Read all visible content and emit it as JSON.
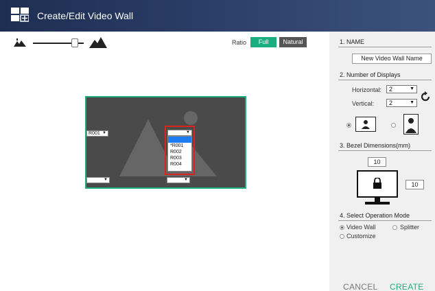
{
  "window": {
    "title": "Create/Edit Video Wall",
    "logo_icon": "video-wall-layout-icon"
  },
  "toolbar": {
    "zoom_out_icon": "mountains-small-icon",
    "zoom_in_icon": "mountains-large-icon",
    "zoom_level": 0.8,
    "ratio_label": "Ratio",
    "ratio_options": [
      "Full",
      "Natural"
    ],
    "ratio_selected": "Full"
  },
  "canvas": {
    "top_left_select": "R001",
    "mid_left_select": "",
    "mid_right_select": "",
    "dropdown": {
      "current": "",
      "options": [
        "*R001",
        "R002",
        "R003",
        "R004"
      ]
    },
    "background_icon": "mountain-image-icon",
    "accent": "#1aae7f",
    "highlight": "#d22222"
  },
  "sidebar": {
    "name": {
      "title": "1. NAME",
      "value": "New Video Wall Name"
    },
    "displays": {
      "title": "2. Number of Displays",
      "horizontal_label": "Horizontal:",
      "horizontal_value": "2",
      "vertical_label": "Vertical:",
      "vertical_value": "2",
      "refresh_icon": "refresh-icon",
      "orientation": [
        "landscape",
        "portrait"
      ],
      "orientation_selected": "landscape"
    },
    "bezel": {
      "title": "3. Bezel Dimensions(mm)",
      "top_value": "10",
      "right_value": "10",
      "lock_icon": "lock-icon"
    },
    "mode": {
      "title": "4. Select Operation Mode",
      "options": [
        "Video Wall",
        "Splitter",
        "Customize"
      ],
      "selected": "Video Wall"
    },
    "cancel_label": "CANCEL",
    "create_label": "CREATE"
  },
  "colors": {
    "brand_dark": "#1e2e52",
    "accent": "#1aae7f",
    "sidebar_bg": "#f0f0f0"
  }
}
